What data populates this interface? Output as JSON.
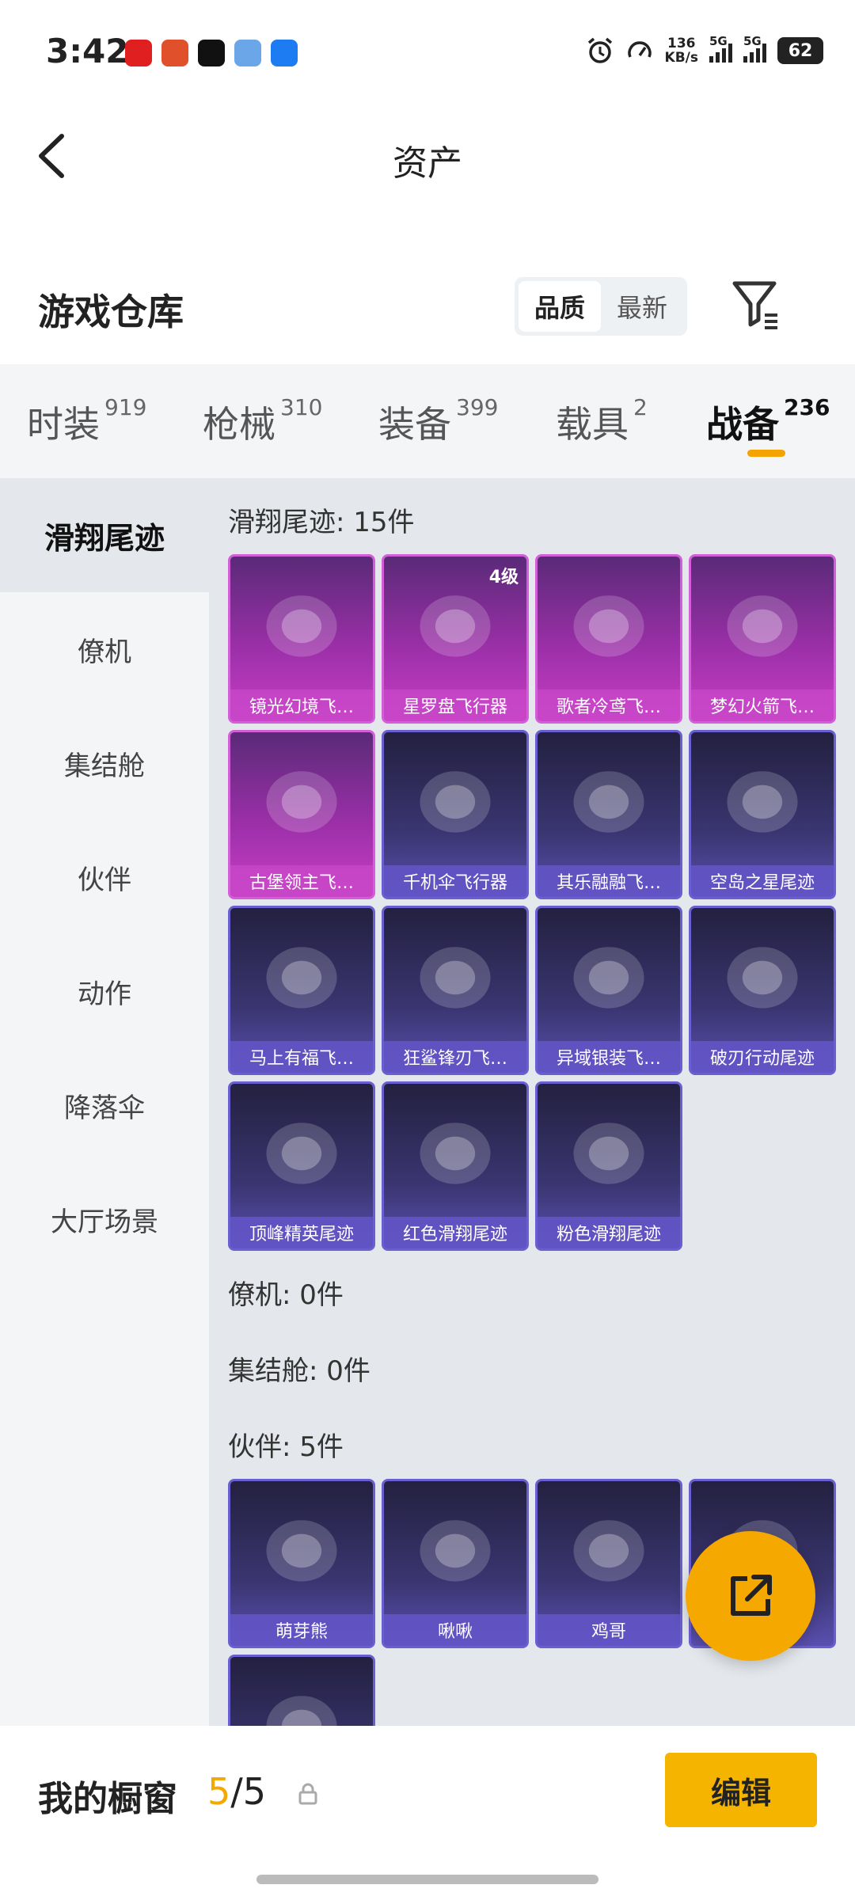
{
  "status": {
    "time": "3:42",
    "speed_value": "136",
    "speed_unit": "KB/s",
    "net1": "5G",
    "net2": "5G",
    "battery": "62",
    "apps": [
      "#e02020",
      "#e0502a",
      "#111111",
      "#6aa6e8",
      "#1e7cf2"
    ]
  },
  "header": {
    "title": "资产"
  },
  "warehouse": {
    "title": "游戏仓库",
    "sort_quality": "品质",
    "sort_newest": "最新"
  },
  "tabs": [
    {
      "label": "时装",
      "count": "919"
    },
    {
      "label": "枪械",
      "count": "310"
    },
    {
      "label": "装备",
      "count": "399"
    },
    {
      "label": "载具",
      "count": "2"
    },
    {
      "label": "战备",
      "count": "236"
    }
  ],
  "sidebar": [
    "滑翔尾迹",
    "僚机",
    "集结舱",
    "伙伴",
    "动作",
    "降落伞",
    "大厅场景"
  ],
  "content": {
    "cat_glide": "滑翔尾迹: 15件",
    "glide_items": [
      {
        "label": "镜光幻境飞…",
        "rarity": "purple"
      },
      {
        "label": "星罗盘飞行器",
        "rarity": "purple",
        "level": "4级"
      },
      {
        "label": "歌者冷鸢飞…",
        "rarity": "purple"
      },
      {
        "label": "梦幻火箭飞…",
        "rarity": "purple"
      },
      {
        "label": "古堡领主飞…",
        "rarity": "purple"
      },
      {
        "label": "千机伞飞行器",
        "rarity": "blue"
      },
      {
        "label": "其乐融融飞…",
        "rarity": "blue"
      },
      {
        "label": "空岛之星尾迹",
        "rarity": "blue"
      },
      {
        "label": "马上有福飞…",
        "rarity": "blue"
      },
      {
        "label": "狂鲨锋刃飞…",
        "rarity": "blue"
      },
      {
        "label": "异域银装飞…",
        "rarity": "blue"
      },
      {
        "label": "破刃行动尾迹",
        "rarity": "blue"
      },
      {
        "label": "顶峰精英尾迹",
        "rarity": "blue"
      },
      {
        "label": "红色滑翔尾迹",
        "rarity": "blue"
      },
      {
        "label": "粉色滑翔尾迹",
        "rarity": "blue"
      }
    ],
    "cat_wingman": "僚机: 0件",
    "cat_pod": "集结舱: 0件",
    "cat_partner": "伙伴: 5件",
    "partner_items": [
      {
        "label": "萌芽熊",
        "rarity": "blue"
      },
      {
        "label": "啾啾",
        "rarity": "blue"
      },
      {
        "label": "鸡哥",
        "rarity": "blue"
      },
      {
        "label": "",
        "rarity": "blue"
      },
      {
        "label": "",
        "rarity": "blue"
      }
    ]
  },
  "bottom": {
    "showcase_label": "我的橱窗",
    "showcase_used": "5",
    "showcase_sep": "/",
    "showcase_total": "5",
    "edit_label": "编辑"
  },
  "colors": {
    "accent": "#f5a800",
    "purple": "#c83fc6",
    "blue": "#5a4fb0"
  }
}
